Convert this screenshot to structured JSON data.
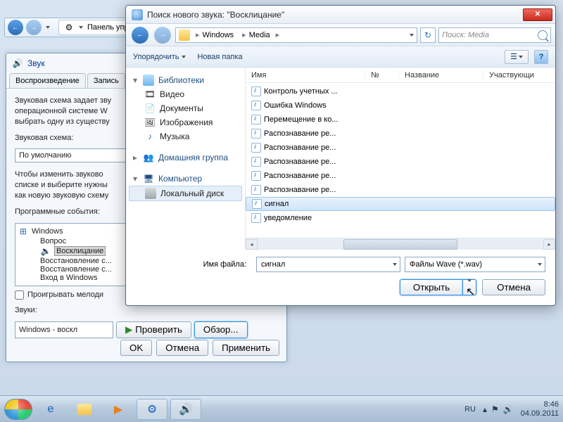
{
  "explorer_bar": {
    "label": "Панель упр"
  },
  "sound": {
    "title": "Звук",
    "tabs": [
      "Воспроизведение",
      "Запись"
    ],
    "desc": "Звуковая схема задает зву\nоперационной системе W\nвыбрать одну из существу",
    "scheme_label": "Звуковая схема:",
    "scheme_value": "По умолчанию",
    "advice": "Чтобы изменить звуково\nсписке и выберите нужны\nкак новую звуковую схему",
    "events_label": "Программные события:",
    "tree": {
      "root": "Windows",
      "children": [
        "Вопрос",
        "Восклицание",
        "Восстановление с...",
        "Восстановление с...",
        "Вход в Windows"
      ]
    },
    "play_melody": "Проигрывать мелоди",
    "sounds_label": "Звуки:",
    "sounds_value": "Windows - воскл",
    "test": "Проверить",
    "browse": "Обзор...",
    "ok": "OK",
    "cancel": "Отмена",
    "apply": "Применить"
  },
  "dialog": {
    "title": "Поиск нового звука: \"Восклицание\"",
    "crumbs": [
      "Windows",
      "Media"
    ],
    "search_placeholder": "Поиск: Media",
    "toolbar": {
      "organize": "Упорядочить",
      "new_folder": "Новая папка"
    },
    "nav": {
      "libs": {
        "head": "Библиотеки",
        "items": [
          "Видео",
          "Документы",
          "Изображения",
          "Музыка"
        ]
      },
      "homegroup": "Домашняя группа",
      "computer": {
        "head": "Компьютер",
        "items": [
          "Локальный диск"
        ]
      }
    },
    "cols": {
      "name": "Имя",
      "no": "№",
      "title": "Название",
      "part": "Участвующи"
    },
    "files": [
      "Контроль учетных ...",
      "Ошибка Windows",
      "Перемещение в ко...",
      "Распознавание ре...",
      "Распознавание ре...",
      "Распознавание ре...",
      "Распознавание ре...",
      "Распознавание ре...",
      "сигнал",
      "уведомление"
    ],
    "selected_index": 8,
    "filename_label": "Имя файла:",
    "filename_value": "сигнал",
    "filetype_value": "Файлы Wave (*.wav)",
    "open": "Открыть",
    "cancel": "Отмена"
  },
  "taskbar": {
    "lang": "RU",
    "time": "8:46",
    "date": "04.09.2011"
  }
}
